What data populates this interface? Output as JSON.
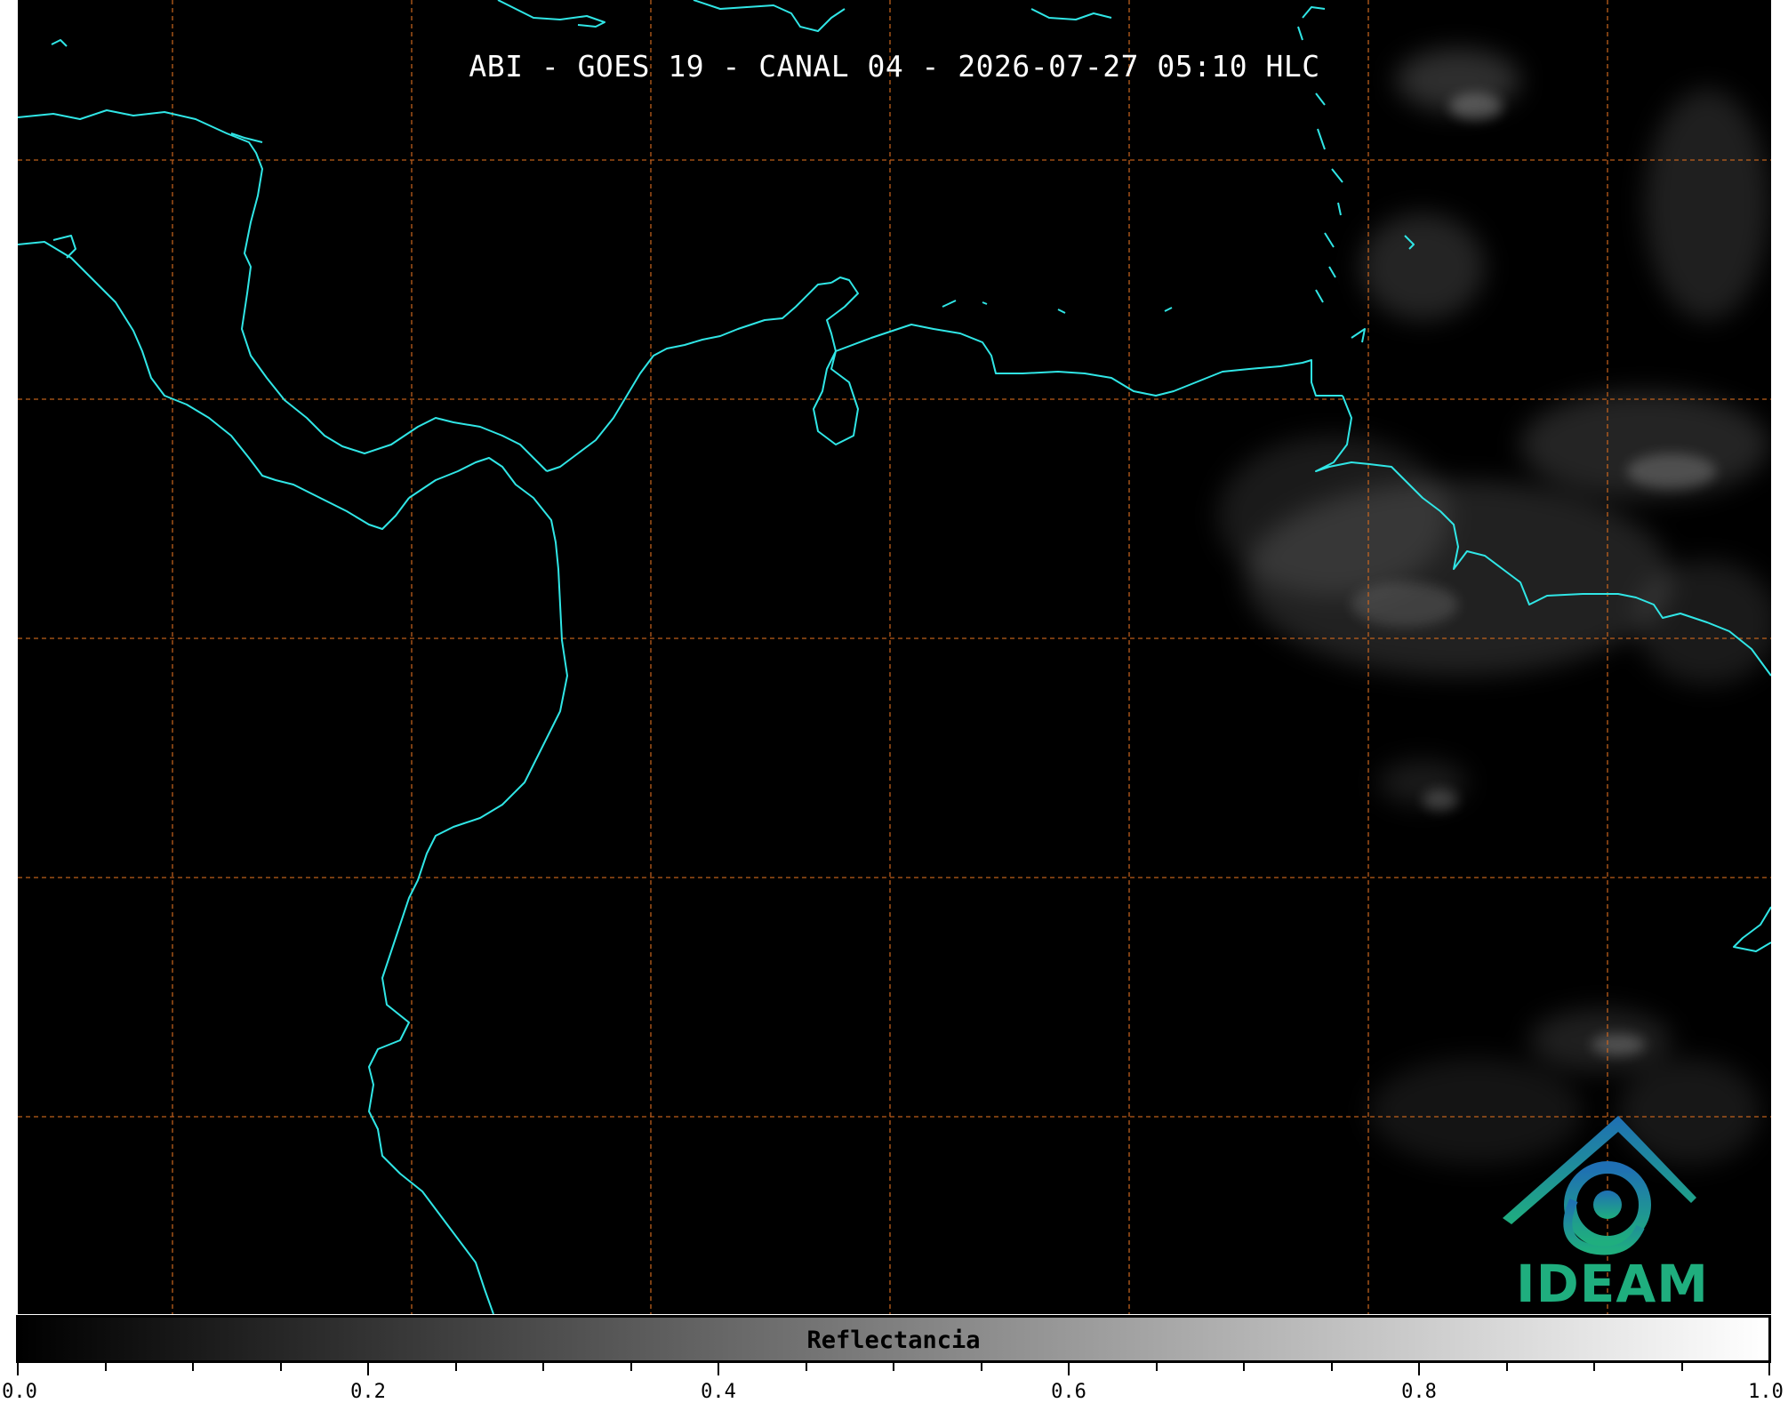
{
  "map": {
    "title": "ABI - GOES 19 - CANAL 04 - 2026-07-27 05:10 HLC",
    "background_color": "#000000",
    "coastline_color": "#30e6e6",
    "gridline_color": "#d2691e",
    "gridline_style": "dashed",
    "cloud_color": "#cfcfcf"
  },
  "logo": {
    "text": "IDEAM",
    "icon": "ideam-logo-icon",
    "colors": [
      "#1f6fb4",
      "#1fae7e"
    ]
  },
  "colorbar": {
    "label": "Reflectancia",
    "min": 0.0,
    "max": 1.0,
    "colormap": "gray",
    "tick_labels": [
      "0.0",
      "0.2",
      "0.4",
      "0.6",
      "0.8",
      "1.0"
    ],
    "major_values": [
      0.0,
      0.2,
      0.4,
      0.6,
      0.8,
      1.0
    ],
    "minor_step": 0.05
  }
}
